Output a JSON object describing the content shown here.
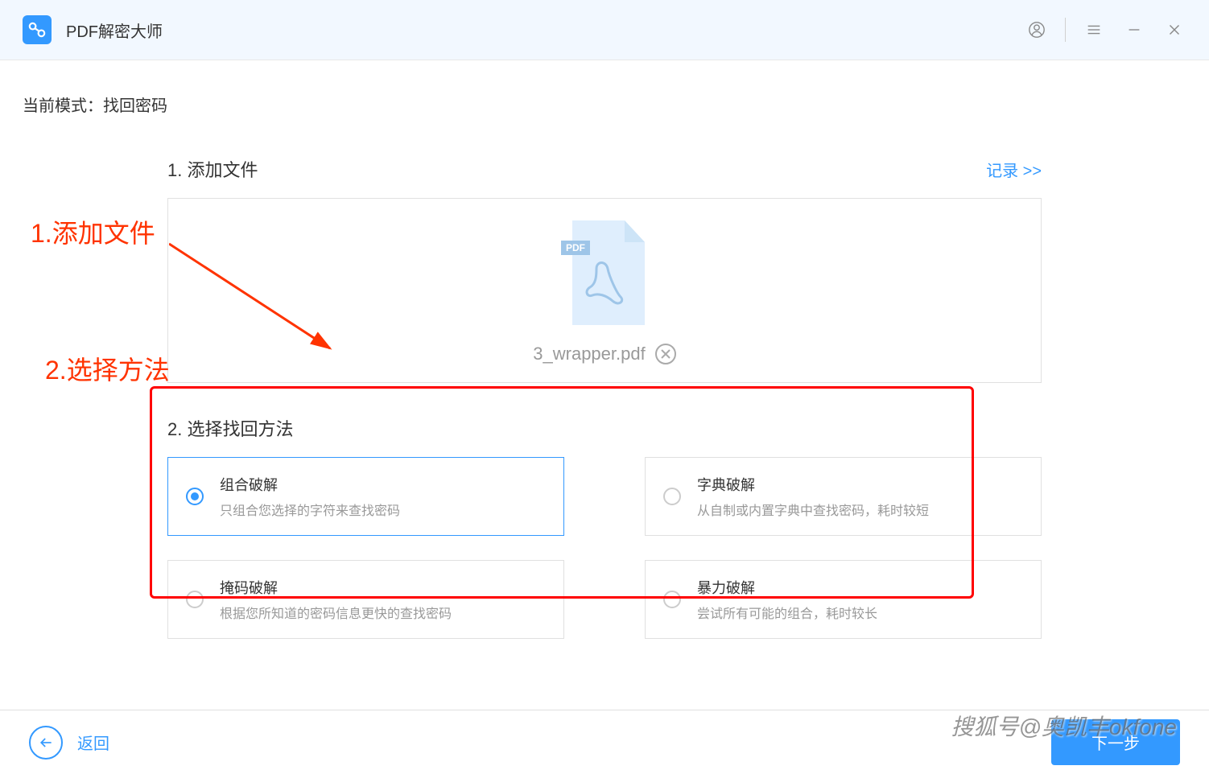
{
  "titlebar": {
    "app_title": "PDF解密大师"
  },
  "mode": {
    "label": "当前模式：找回密码"
  },
  "annotations": {
    "a1": "1.添加文件",
    "a2": "2.选择方法"
  },
  "step1": {
    "title": "1. 添加文件",
    "records_link": "记录 >>",
    "file": {
      "name": "3_wrapper.pdf",
      "badge": "PDF"
    }
  },
  "step2": {
    "title": "2. 选择找回方法",
    "options": [
      {
        "title": "组合破解",
        "desc": "只组合您选择的字符来查找密码",
        "selected": true
      },
      {
        "title": "字典破解",
        "desc": "从自制或内置字典中查找密码，耗时较短",
        "selected": false
      },
      {
        "title": "掩码破解",
        "desc": "根据您所知道的密码信息更快的查找密码",
        "selected": false
      },
      {
        "title": "暴力破解",
        "desc": "尝试所有可能的组合，耗时较长",
        "selected": false
      }
    ]
  },
  "footer": {
    "back": "返回",
    "next": "下一步"
  },
  "watermark": "搜狐号@奥凯丰okfone"
}
